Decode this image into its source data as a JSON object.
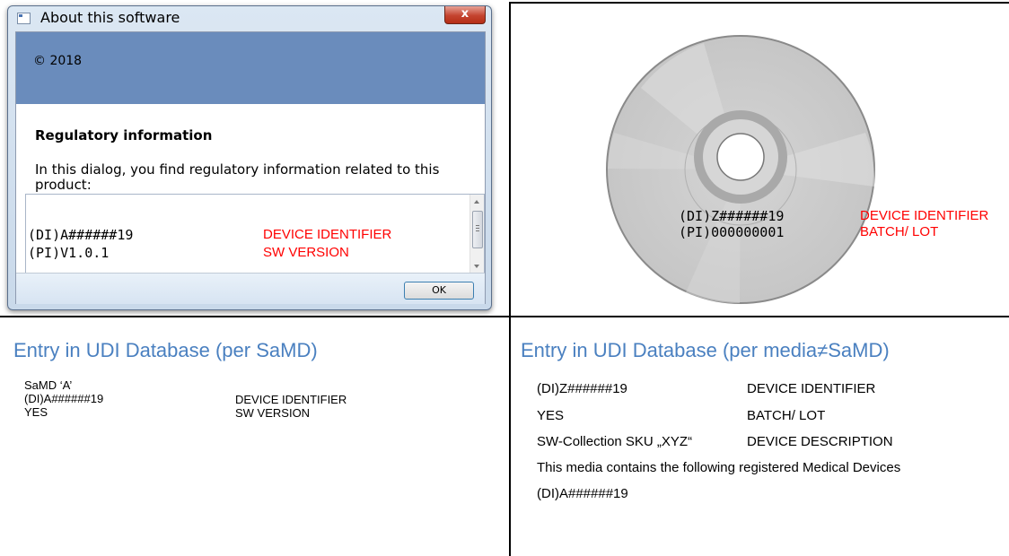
{
  "dialog": {
    "title": "About this software",
    "close_label": "x",
    "copyright": "© 2018",
    "heading": "Regulatory information",
    "description": "In this dialog, you find regulatory information related to this product:",
    "list": [
      {
        "code": "(DI)A######19",
        "label": "DEVICE IDENTIFIER"
      },
      {
        "code": "(PI)V1.0.1",
        "label": "SW VERSION"
      }
    ],
    "ok_label": "OK"
  },
  "cd": {
    "rows": [
      {
        "code": "(DI)Z######19",
        "label": "DEVICE IDENTIFIER"
      },
      {
        "code": "(PI)000000001",
        "label": "BATCH/ LOT"
      }
    ]
  },
  "samd_entry": {
    "title": "Entry in UDI Database (per SaMD)",
    "name": "SaMD ‘A’",
    "rows": [
      {
        "code": "(DI)A######19",
        "label": "DEVICE IDENTIFIER"
      },
      {
        "code": "YES",
        "label": "SW VERSION"
      }
    ]
  },
  "media_entry": {
    "title": "Entry in UDI Database (per media≠SaMD)",
    "rows": [
      {
        "code": "(DI)Z######19",
        "label": "DEVICE IDENTIFIER"
      },
      {
        "code": "YES",
        "label": "BATCH/ LOT"
      },
      {
        "code": "SW-Collection SKU „XYZ“",
        "label": "DEVICE DESCRIPTION"
      }
    ],
    "note": "This media contains the following registered Medical Devices",
    "contained_device": "(DI)A######19"
  },
  "colors": {
    "accent_red": "#ff0000",
    "title_blue": "#4a80c0",
    "dialog_header": "#6a8cbc"
  }
}
